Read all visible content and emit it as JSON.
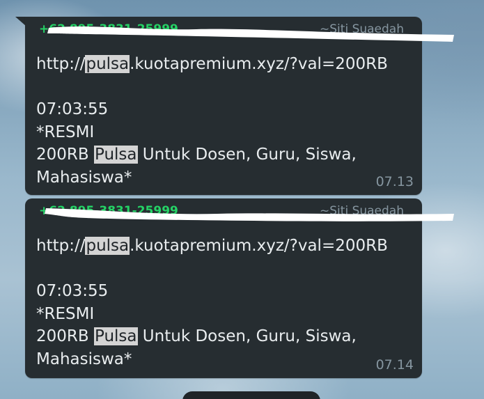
{
  "messages": [
    {
      "sender_phone": "+62 895-3831-25999",
      "sender_name": "~Siti Suaedah",
      "link_prefix": "http://",
      "link_highlight": "pulsa",
      "link_suffix": ".kuotapremium.xyz/?val=200RB",
      "clock": "07:03:55",
      "line_resmi": "*RESMI",
      "promo_prefix": "200RB ",
      "promo_highlight": "Pulsa",
      "promo_suffix": " Untuk Dosen, Guru, Siswa,",
      "promo_end": "Mahasiswa*",
      "time": "07.13"
    },
    {
      "sender_phone": "+62 895-3831-25999",
      "sender_name": "~Siti Suaedah",
      "link_prefix": "http://",
      "link_highlight": "pulsa",
      "link_suffix": ".kuotapremium.xyz/?val=200RB",
      "clock": "07:03:55",
      "line_resmi": "*RESMI",
      "promo_prefix": "200RB ",
      "promo_highlight": "Pulsa",
      "promo_suffix": " Untuk Dosen, Guru, Siswa,",
      "promo_end": "Mahasiswa*",
      "time": "07.14"
    }
  ],
  "colors": {
    "bubble": "#262d31",
    "sender_phone": "#25d366",
    "meta": "#8696a0",
    "highlight": "#d4d4d4"
  }
}
